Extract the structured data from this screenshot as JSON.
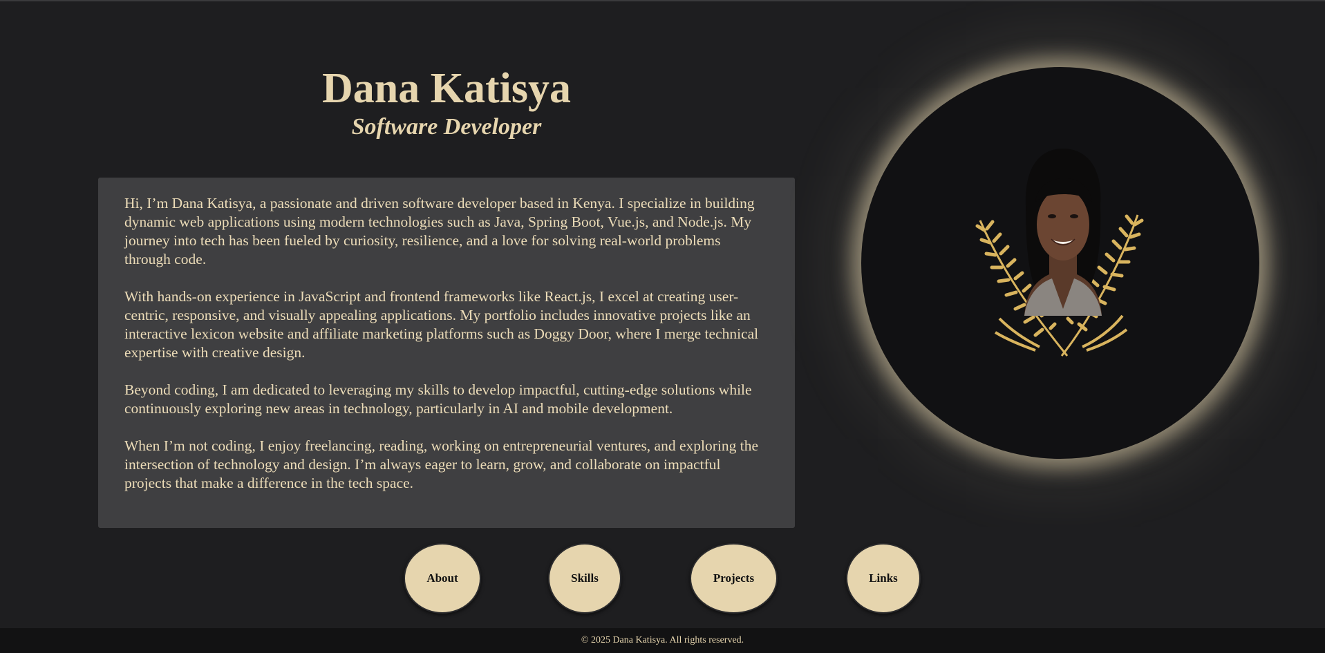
{
  "header": {
    "name": "Dana Katisya",
    "role": "Software Developer"
  },
  "bio": {
    "paragraphs": [
      "Hi, I’m Dana Katisya, a passionate and driven software developer based in Kenya. I specialize in building dynamic web applications using modern technologies such as Java, Spring Boot, Vue.js, and Node.js. My journey into tech has been fueled by curiosity, resilience, and a love for solving real-world problems through code.",
      "With hands-on experience in JavaScript and frontend frameworks like React.js, I excel at creating user-centric, responsive, and visually appealing applications. My portfolio includes innovative projects like an interactive lexicon website and affiliate marketing platforms such as Doggy Door, where I merge technical expertise with creative design.",
      "Beyond coding, I am dedicated to leveraging my skills to develop impactful, cutting-edge solutions while continuously exploring new areas in technology, particularly in AI and mobile development.",
      "When I’m not coding, I enjoy freelancing, reading, working on entrepreneurial ventures, and exploring the intersection of technology and design. I’m always eager to learn, grow, and collaborate on impactful projects that make a difference in the tech space."
    ]
  },
  "portrait": {
    "icon": "profile-photo-with-gold-leaves",
    "glow_color": "#e6d5ae"
  },
  "nav": {
    "about": "About",
    "skills": "Skills",
    "projects": "Projects",
    "links": "Links"
  },
  "footer": {
    "text": "© 2025 Dana Katisya. All rights reserved."
  },
  "colors": {
    "background": "#1e1e20",
    "accent": "#e6d5ae",
    "card": "#3f3f41",
    "footer": "#121213"
  }
}
